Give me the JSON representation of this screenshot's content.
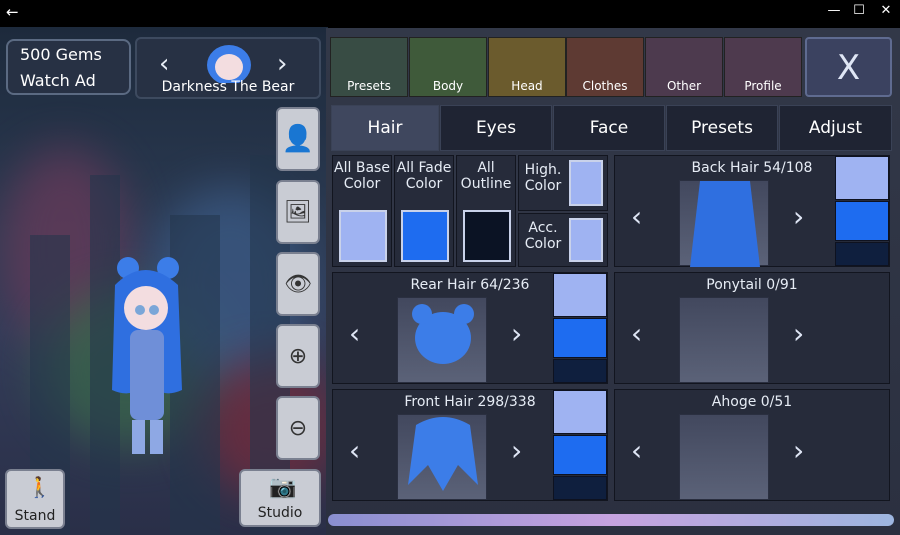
{
  "titlebar": {
    "back": "←",
    "minimize": "—",
    "maximize": "☐",
    "close": "✕"
  },
  "gems": {
    "count": "500 Gems",
    "watch": "Watch Ad"
  },
  "character": {
    "name": "Darkness The Bear"
  },
  "side_buttons": [
    "add-person",
    "background",
    "visibility",
    "zoom-in",
    "zoom-out"
  ],
  "stand": {
    "label": "Stand"
  },
  "studio": {
    "label": "Studio"
  },
  "tabs": [
    {
      "label": "Presets"
    },
    {
      "label": "Body"
    },
    {
      "label": "Head"
    },
    {
      "label": "Clothes"
    },
    {
      "label": "Other"
    },
    {
      "label": "Profile"
    }
  ],
  "close": "X",
  "subtabs": [
    {
      "label": "Hair"
    },
    {
      "label": "Eyes"
    },
    {
      "label": "Face"
    },
    {
      "label": "Presets"
    },
    {
      "label": "Adjust"
    }
  ],
  "colors": {
    "all_base": "All Base Color",
    "all_fade": "All Fade Color",
    "all_outline": "All Outline",
    "high": "High. Color",
    "acc": "Acc. Color"
  },
  "hair": {
    "back": "Back Hair 54/108",
    "rear": "Rear Hair 64/236",
    "front": "Front Hair 298/338",
    "ponytail": "Ponytail 0/91",
    "ahoge": "Ahoge 0/51"
  },
  "palette": {
    "light": "#9fb3f2",
    "mid": "#1e6cf0",
    "dark": "#0f1f3e",
    "outline": "#0b1324",
    "accent": "#5a8ff0"
  }
}
